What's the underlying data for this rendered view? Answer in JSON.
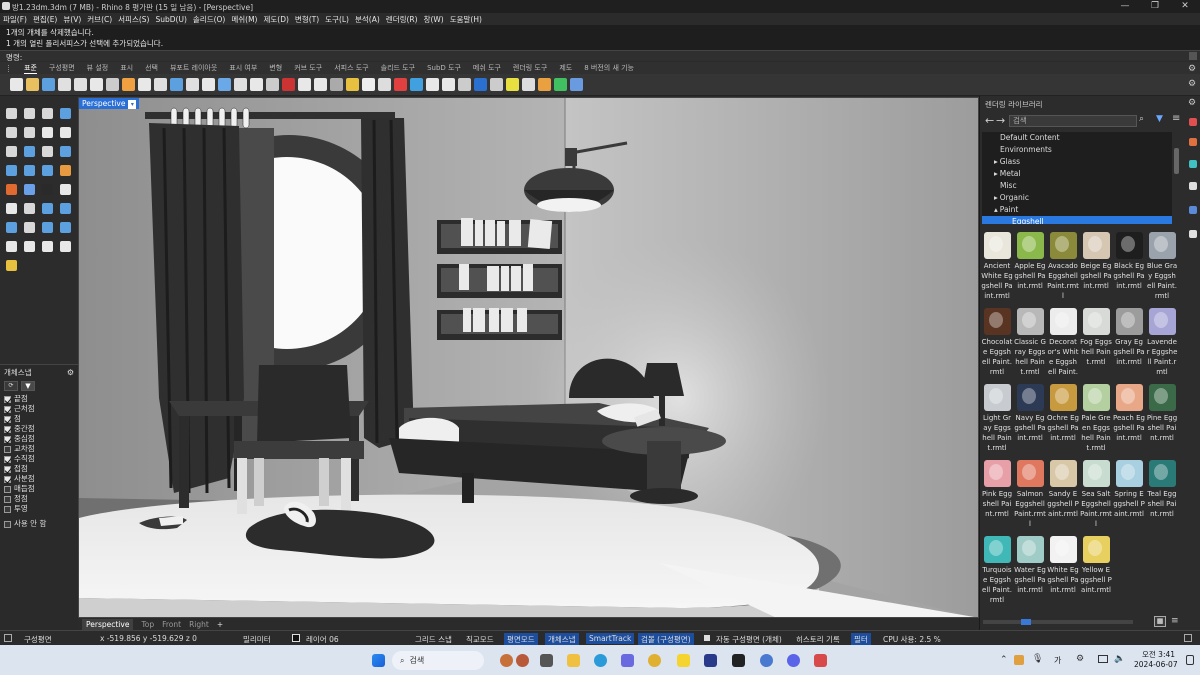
{
  "window": {
    "title": "방1.23dm.3dm (7 MB) - Rhino 8 평가판 (15 일 남음) - [Perspective]"
  },
  "menu": [
    "파일(F)",
    "편집(E)",
    "뷰(V)",
    "커브(C)",
    "서피스(S)",
    "SubD(U)",
    "솔리드(O)",
    "메쉬(M)",
    "제도(D)",
    "변형(T)",
    "도구(L)",
    "분석(A)",
    "렌더링(R)",
    "창(W)",
    "도움말(H)"
  ],
  "history": [
    "1개의 개체를 삭제했습니다.",
    "1 개의 열린 폴리서피스가 선택에 추가되었습니다."
  ],
  "command": {
    "prompt": "명령:"
  },
  "toolbar_tabs": [
    "표준",
    "구성평면",
    "뷰 설정",
    "표시",
    "선택",
    "뷰포트 레이아웃",
    "표시 여부",
    "변형",
    "커브 도구",
    "서피스 도구",
    "솔리드 도구",
    "SubD 도구",
    "메쉬 도구",
    "렌더링 도구",
    "제도",
    "8 버전의 새 기능"
  ],
  "toolbar_icon_colors": [
    "#e8e8e8",
    "#e8c060",
    "#5da0e0",
    "#e0e0e0",
    "#e0e0e0",
    "#e8e8e8",
    "#cccccc",
    "#f0a040",
    "#e8e8e8",
    "#e0e0e0",
    "#5da0e0",
    "#e0e0e0",
    "#e8e8e8",
    "#6aa8e8",
    "#e0e0e0",
    "#e8e8e8",
    "#cccccc",
    "#cc3333",
    "#e8e8e8",
    "#e8e8e8",
    "#aaaaaa",
    "#e8c040",
    "#eeeeee",
    "#dddddd",
    "#e04040",
    "#40a0e0",
    "#e8e8e8",
    "#e8e8e8",
    "#cccccc",
    "#2a70d0",
    "#cccccc",
    "#e8e040",
    "#dddddd",
    "#e8a040",
    "#40c060",
    "#6a9ae0"
  ],
  "osnap": {
    "title": "개체스냅",
    "items": [
      {
        "label": "끝점",
        "checked": true
      },
      {
        "label": "근처점",
        "checked": true
      },
      {
        "label": "점",
        "checked": true
      },
      {
        "label": "중간점",
        "checked": true
      },
      {
        "label": "중심점",
        "checked": true
      },
      {
        "label": "교차점",
        "checked": false
      },
      {
        "label": "수직점",
        "checked": true
      },
      {
        "label": "접점",
        "checked": true
      },
      {
        "label": "사분점",
        "checked": true
      },
      {
        "label": "매듭점",
        "checked": false
      },
      {
        "label": "정점",
        "checked": false
      },
      {
        "label": "투영",
        "checked": false
      }
    ],
    "disable_label": "사용 안 함"
  },
  "viewport": {
    "label": "Perspective",
    "tabs": [
      "Perspective",
      "Top",
      "Front",
      "Right"
    ],
    "add_tab": "+"
  },
  "render_library": {
    "title": "렌더링 라이브러리",
    "search_placeholder": "검색",
    "tree": [
      {
        "label": "Default Content",
        "indent": 1,
        "arrow": "",
        "selected": false
      },
      {
        "label": "Environments",
        "indent": 1,
        "arrow": "",
        "selected": false
      },
      {
        "label": "Glass",
        "indent": 1,
        "arrow": "▸",
        "selected": false
      },
      {
        "label": "Metal",
        "indent": 1,
        "arrow": "▸",
        "selected": false
      },
      {
        "label": "Misc",
        "indent": 1,
        "arrow": "",
        "selected": false
      },
      {
        "label": "Organic",
        "indent": 1,
        "arrow": "▸",
        "selected": false
      },
      {
        "label": "Paint",
        "indent": 1,
        "arrow": "▴",
        "selected": false
      },
      {
        "label": "Eggshell",
        "indent": 2,
        "arrow": "",
        "selected": true
      }
    ],
    "materials": [
      {
        "name": "Ancient White Eggshell Paint.rmtl",
        "color": "#e9e6dc"
      },
      {
        "name": "Apple Eggshell Paint.rmtl",
        "color": "#8bb84a"
      },
      {
        "name": "Avacado Eggshell Paint.rmtl",
        "color": "#8a8a3a"
      },
      {
        "name": "Beige Eggshell Paint.rmtl",
        "color": "#d6c7b2"
      },
      {
        "name": "Black Eggshell Paint.rmtl",
        "color": "#1e1e1e"
      },
      {
        "name": "Blue Gray Eggshell Paint.rmtl",
        "color": "#9aa3ac"
      },
      {
        "name": "Chocolate Eggshell Paint.rmtl",
        "color": "#5a3422"
      },
      {
        "name": "Classic Gray Eggshell Paint.rmtl",
        "color": "#b8b8b8"
      },
      {
        "name": "Decorator's White Eggshell Paint.",
        "color": "#ececec"
      },
      {
        "name": "Fog Eggshell Paint.rmtl",
        "color": "#d8dad8"
      },
      {
        "name": "Gray Eggshell Paint.rmtl",
        "color": "#9c9c9c"
      },
      {
        "name": "Lavender Eggshell Paint.rmtl",
        "color": "#a7a4d6"
      },
      {
        "name": "Light Gray Eggshell Paint.rmtl",
        "color": "#c8ccd0"
      },
      {
        "name": "Navy Eggshell Paint.rmtl",
        "color": "#2c3a55"
      },
      {
        "name": "Ochre Eggshell Paint.rmtl",
        "color": "#c89a40"
      },
      {
        "name": "Pale Green Eggshell Paint.rmtl",
        "color": "#b4d0a0"
      },
      {
        "name": "Peach Eggshell Paint.rmtl",
        "color": "#e8a888"
      },
      {
        "name": "Pine Eggshell Paint.rmtl",
        "color": "#3a6a48"
      },
      {
        "name": "Pink Eggshell Paint.rmtl",
        "color": "#e8a0a8"
      },
      {
        "name": "Salmon Eggshell Paint.rmtl",
        "color": "#e07860"
      },
      {
        "name": "Sandy Eggshell Paint.rmtl",
        "color": "#d8c8a8"
      },
      {
        "name": "Sea Salt Eggshell Paint.rmtl",
        "color": "#c8dcd0"
      },
      {
        "name": "Spring Eggshell Paint.rmtl",
        "color": "#a8d0e0"
      },
      {
        "name": "Teal Eggshell Paint.rmtl",
        "color": "#2a7a78"
      },
      {
        "name": "Turquoise Eggshell Paint.rmtl",
        "color": "#40b8b8"
      },
      {
        "name": "Water Eggshell Paint.rmtl",
        "color": "#a0ccc8"
      },
      {
        "name": "White Eggshell Paint.rmtl",
        "color": "#f2f2f2"
      },
      {
        "name": "Yellow Eggshell Paint.rmtl",
        "color": "#e8d060"
      }
    ]
  },
  "statusbar": {
    "cplane": "구성평면",
    "coords": "x -519.856  y -519.629  z 0",
    "units": "밀리미터",
    "layer": "레이어 06",
    "grid_snap": "그리드 스냅",
    "ortho": "직교모드",
    "planar": "평면모드",
    "osnap": "개체스냅",
    "smarttrack": "SmartTrack",
    "gumball": "검볼 (구성평면)",
    "auto_cplane": "자동 구성평면 (개체)",
    "history": "히스토리 기록",
    "filter": "필터",
    "cpu": "CPU 사용: 2.5 %"
  },
  "taskbar": {
    "search": "검색",
    "ime": "가",
    "time": "오전 3:41",
    "date": "2024-06-07"
  }
}
